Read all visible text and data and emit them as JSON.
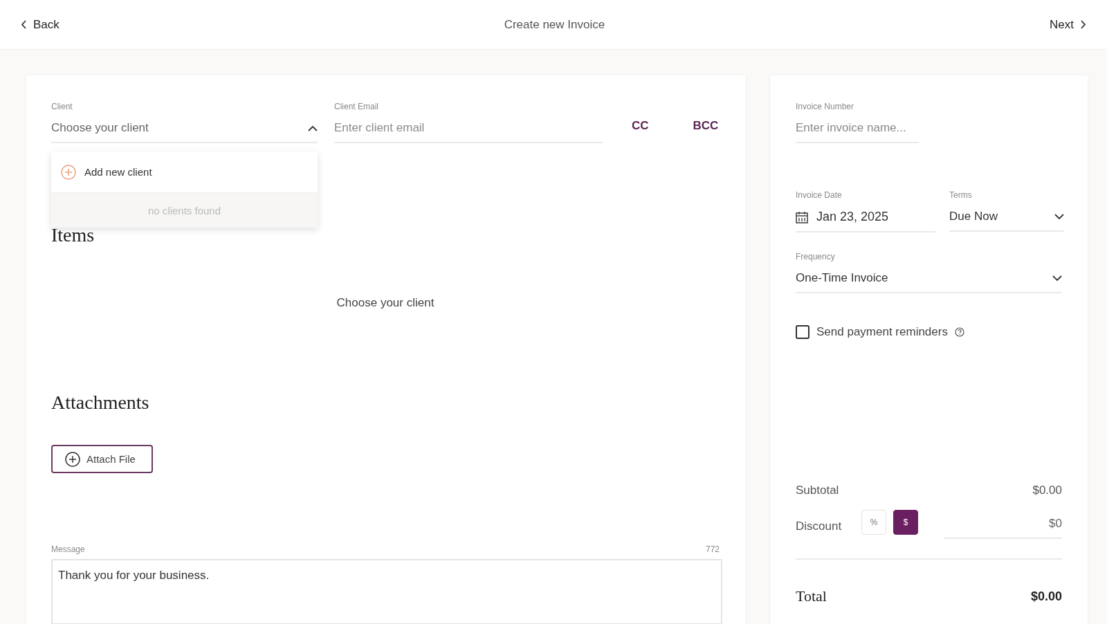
{
  "header": {
    "back": "Back",
    "title": "Create new Invoice",
    "next": "Next"
  },
  "client": {
    "label": "Client",
    "placeholder": "Choose your client",
    "expanded": true,
    "dropdown": {
      "add_item": "Add new client",
      "empty": "no clients found"
    }
  },
  "client_email": {
    "label": "Client Email",
    "placeholder": "Enter client email"
  },
  "copy_buttons": [
    "CC",
    "BCC"
  ],
  "items": {
    "title": "Items",
    "empty": "Choose your client"
  },
  "attachments": {
    "title": "Attachments",
    "button": "Attach File"
  },
  "message": {
    "label": "Message",
    "count": "772",
    "value": "Thank you for your business."
  },
  "invoice_number": {
    "label": "Invoice Number",
    "placeholder": "Enter invoice name..."
  },
  "invoice_date": {
    "label": "Invoice Date",
    "value": "Jan 23, 2025"
  },
  "terms": {
    "label": "Terms",
    "value": "Due Now"
  },
  "frequency": {
    "label": "Frequency",
    "value": "One-Time Invoice"
  },
  "reminders": {
    "label": "Send payment reminders",
    "checked": false
  },
  "summary": {
    "subtotal_label": "Subtotal",
    "subtotal": "$0.00",
    "discount_label": "Discount",
    "discount_types": [
      {
        "label": "%",
        "selected": false
      },
      {
        "label": "$",
        "selected": true
      }
    ],
    "discount_value": "$0",
    "total_label": "Total",
    "total": "$0.00"
  }
}
